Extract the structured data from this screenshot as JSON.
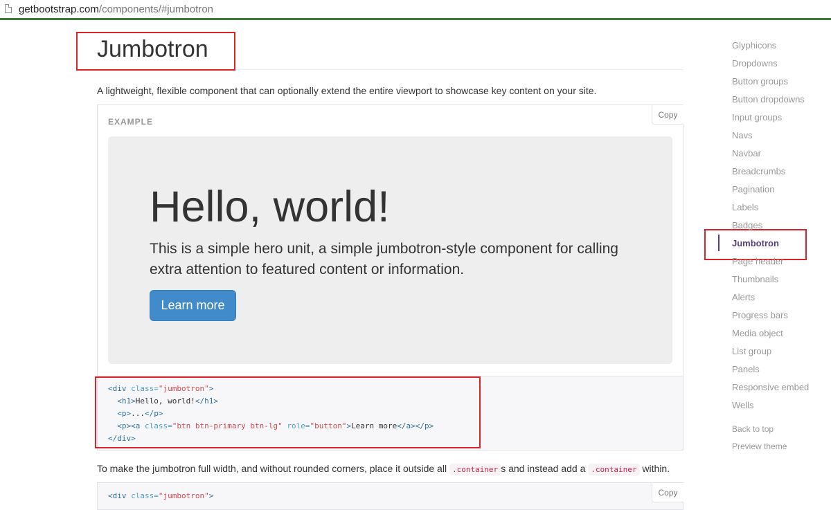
{
  "browser": {
    "url_domain": "getbootstrap.com",
    "url_path": "/components/#jumbotron"
  },
  "page": {
    "title": "Jumbotron",
    "lead": "A lightweight, flexible component that can optionally extend the entire viewport to showcase key content on your site."
  },
  "example": {
    "label": "EXAMPLE",
    "copy_label": "Copy",
    "heading": "Hello, world!",
    "text": "This is a simple hero unit, a simple jumbotron-style component for calling extra attention to featured content or information.",
    "button_label": "Learn more"
  },
  "code1": {
    "copy_label": "Copy",
    "lines": [
      "<div class=\"jumbotron\">",
      "  <h1>Hello, world!</h1>",
      "  <p>...</p>",
      "  <p><a class=\"btn btn-primary btn-lg\" role=\"button\">Learn more</a></p>",
      "</div>"
    ]
  },
  "para2": {
    "part1": "To make the jumbotron full width, and without rounded corners, place it outside all ",
    "code1": ".container",
    "part2": "s and instead add a ",
    "code2": ".container",
    "part3": " within."
  },
  "code2": {
    "copy_label": "Copy",
    "first_line": "<div class=\"jumbotron\">"
  },
  "sidebar": {
    "items": [
      {
        "label": "Glyphicons",
        "active": false
      },
      {
        "label": "Dropdowns",
        "active": false
      },
      {
        "label": "Button groups",
        "active": false
      },
      {
        "label": "Button dropdowns",
        "active": false
      },
      {
        "label": "Input groups",
        "active": false
      },
      {
        "label": "Navs",
        "active": false
      },
      {
        "label": "Navbar",
        "active": false
      },
      {
        "label": "Breadcrumbs",
        "active": false
      },
      {
        "label": "Pagination",
        "active": false
      },
      {
        "label": "Labels",
        "active": false
      },
      {
        "label": "Badges",
        "active": false
      },
      {
        "label": "Jumbotron",
        "active": true
      },
      {
        "label": "Page header",
        "active": false
      },
      {
        "label": "Thumbnails",
        "active": false
      },
      {
        "label": "Alerts",
        "active": false
      },
      {
        "label": "Progress bars",
        "active": false
      },
      {
        "label": "Media object",
        "active": false
      },
      {
        "label": "List group",
        "active": false
      },
      {
        "label": "Panels",
        "active": false
      },
      {
        "label": "Responsive embed",
        "active": false
      },
      {
        "label": "Wells",
        "active": false
      }
    ],
    "back_to_top": "Back to top",
    "preview_theme": "Preview theme"
  },
  "colors": {
    "primary_button": "#428bca",
    "active_nav": "#563d7c",
    "annotation_box": "#d8232a"
  }
}
